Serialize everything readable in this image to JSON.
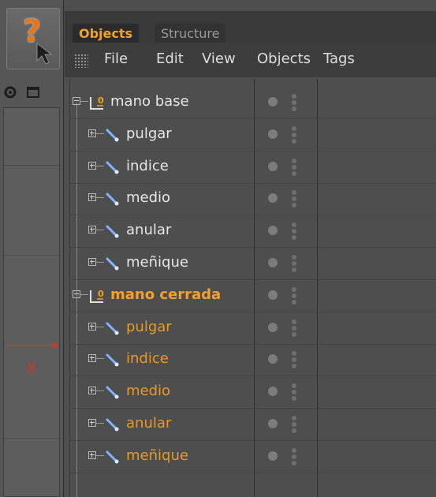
{
  "toolbar": {
    "help_button": {
      "symbol": "?",
      "icon": "help-cursor-icon"
    },
    "viewport_icons": [
      "rotate-icon",
      "maximize-icon"
    ]
  },
  "viewport": {
    "axis_label": "X",
    "axis_color": "#c83a2a"
  },
  "manager": {
    "tabs": [
      {
        "label": "Objects",
        "active": true
      },
      {
        "label": "Structure",
        "active": false
      }
    ],
    "menu": [
      "File",
      "Edit",
      "View",
      "Objects",
      "Tags"
    ],
    "objects": [
      {
        "label": "mano base",
        "type": "null",
        "level": 0,
        "style": "white"
      },
      {
        "label": "pulgar",
        "type": "bone",
        "level": 1,
        "style": "white"
      },
      {
        "label": "indice",
        "type": "bone",
        "level": 1,
        "style": "white"
      },
      {
        "label": "medio",
        "type": "bone",
        "level": 1,
        "style": "white"
      },
      {
        "label": "anular",
        "type": "bone",
        "level": 1,
        "style": "white"
      },
      {
        "label": "meñique",
        "type": "bone",
        "level": 1,
        "style": "white"
      },
      {
        "label": "mano cerrada",
        "type": "null",
        "level": 0,
        "style": "orange-bold"
      },
      {
        "label": "pulgar",
        "type": "bone",
        "level": 1,
        "style": "orange"
      },
      {
        "label": "indice",
        "type": "bone",
        "level": 1,
        "style": "orange"
      },
      {
        "label": "medio",
        "type": "bone",
        "level": 1,
        "style": "orange"
      },
      {
        "label": "anular",
        "type": "bone",
        "level": 1,
        "style": "orange"
      },
      {
        "label": "meñique",
        "type": "bone",
        "level": 1,
        "style": "orange"
      }
    ],
    "colors": {
      "accent_orange": "#f4a02a",
      "selected_orange": "#e59a2b",
      "text": "#e6e6e6"
    }
  }
}
